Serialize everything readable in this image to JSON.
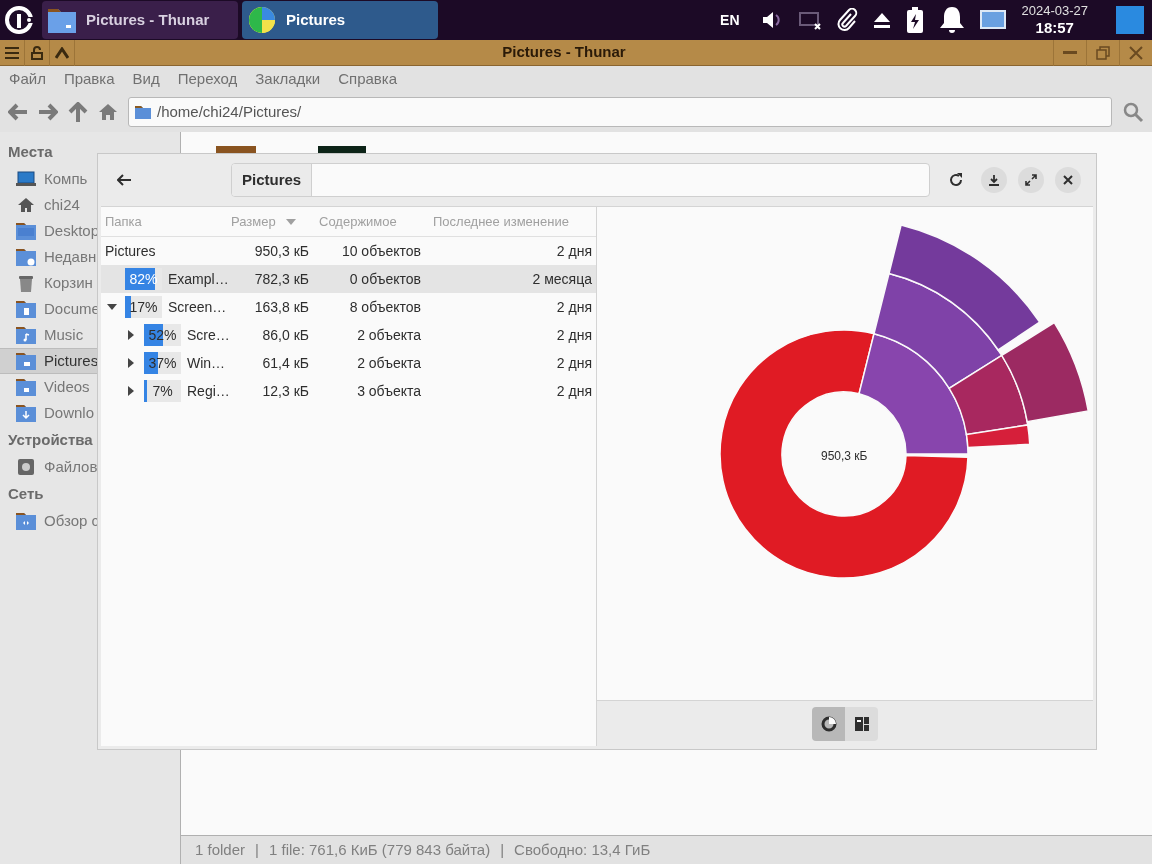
{
  "taskbar": {
    "tasks": [
      {
        "label": "Pictures - Thunar",
        "selected": false
      },
      {
        "label": "Pictures",
        "selected": true
      }
    ],
    "tray": {
      "language": "EN",
      "date": "2024-03-27",
      "time": "18:57"
    }
  },
  "window": {
    "title": "Pictures - Thunar",
    "menu": [
      "Файл",
      "Правка",
      "Вид",
      "Переход",
      "Закладки",
      "Справка"
    ],
    "location": "/home/chi24/Pictures/"
  },
  "sidebar": {
    "sections": [
      {
        "title": "Места",
        "items": [
          {
            "label": "Компь",
            "selected": false
          },
          {
            "label": "chi24",
            "selected": false
          },
          {
            "label": "Desktop",
            "selected": false
          },
          {
            "label": "Недавн",
            "selected": false
          },
          {
            "label": "Корзин",
            "selected": false
          },
          {
            "label": "Docume",
            "selected": false
          },
          {
            "label": "Music",
            "selected": false
          },
          {
            "label": "Pictures",
            "selected": true
          },
          {
            "label": "Videos",
            "selected": false
          },
          {
            "label": "Downlo",
            "selected": false
          }
        ]
      },
      {
        "title": "Устройства",
        "items": [
          {
            "label": "Файлов",
            "selected": false
          }
        ]
      },
      {
        "title": "Сеть",
        "items": [
          {
            "label": "Обзор с",
            "selected": false
          }
        ]
      }
    ]
  },
  "analyzer": {
    "path": "Pictures",
    "columns": [
      "Папка",
      "Размер",
      "Содержимое",
      "Последнее изменение"
    ],
    "rows": [
      {
        "name": "Pictures",
        "size": "950,3 кБ",
        "contents": "10 объектов",
        "modified": "2 дня",
        "selected": false,
        "children": [
          {
            "name": "Exampl…",
            "percent": "82%",
            "level": 0.82,
            "size": "782,3 кБ",
            "contents": "0 объектов",
            "modified": "2 месяца",
            "selected": true
          },
          {
            "name": "Screen…",
            "percent": "17%",
            "level": 0.17,
            "size": "163,8 кБ",
            "contents": "8 объектов",
            "modified": "2 дня",
            "selected": false,
            "expanded": true,
            "children": [
              {
                "name": "Scre…",
                "percent": "52%",
                "level": 0.52,
                "size": "86,0 кБ",
                "contents": "2 объекта",
                "modified": "2 дня",
                "selected": false,
                "expanded": false
              },
              {
                "name": "Win…",
                "percent": "37%",
                "level": 0.37,
                "size": "61,4 кБ",
                "contents": "2 объекта",
                "modified": "2 дня",
                "selected": false,
                "expanded": false
              },
              {
                "name": "Regi…",
                "percent": "7%",
                "level": 0.07,
                "size": "12,3 кБ",
                "contents": "3 объекта",
                "modified": "2 дня",
                "selected": false,
                "expanded": false
              }
            ]
          }
        ]
      }
    ],
    "total": "950,3 кБ",
    "views": [
      {
        "kind": "rings",
        "selected": true
      },
      {
        "kind": "treemap",
        "selected": false
      }
    ]
  },
  "status_bar": {
    "texts": [
      "1 folder",
      "|",
      "1 file: 761,6 КиБ (779 843 байта)",
      "|",
      "Свободно: 13,4 ГиБ"
    ]
  }
}
